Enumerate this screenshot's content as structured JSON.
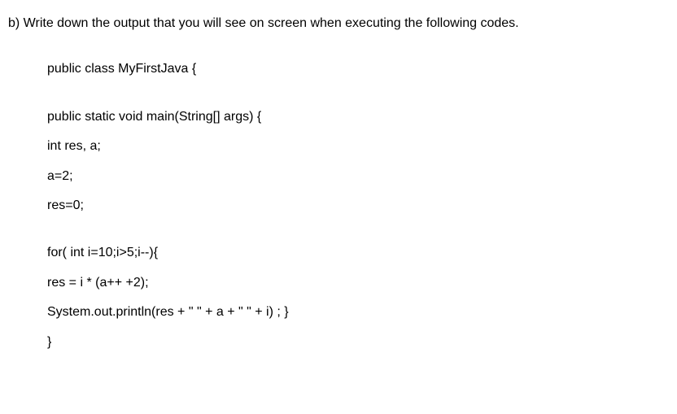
{
  "question": "b) Write down the output that you will see on screen when executing the following codes.",
  "code": {
    "l1": "public class MyFirstJava {",
    "l2": "public static void main(String[] args) {",
    "l3": "int res, a;",
    "l4": "a=2;",
    "l5": "res=0;",
    "l6": "for( int i=10;i>5;i--){",
    "l7": "res = i * (a++ +2);",
    "l8": "System.out.println(res + \" \" + a + \" \" + i) ;  }",
    "l9": "}"
  }
}
